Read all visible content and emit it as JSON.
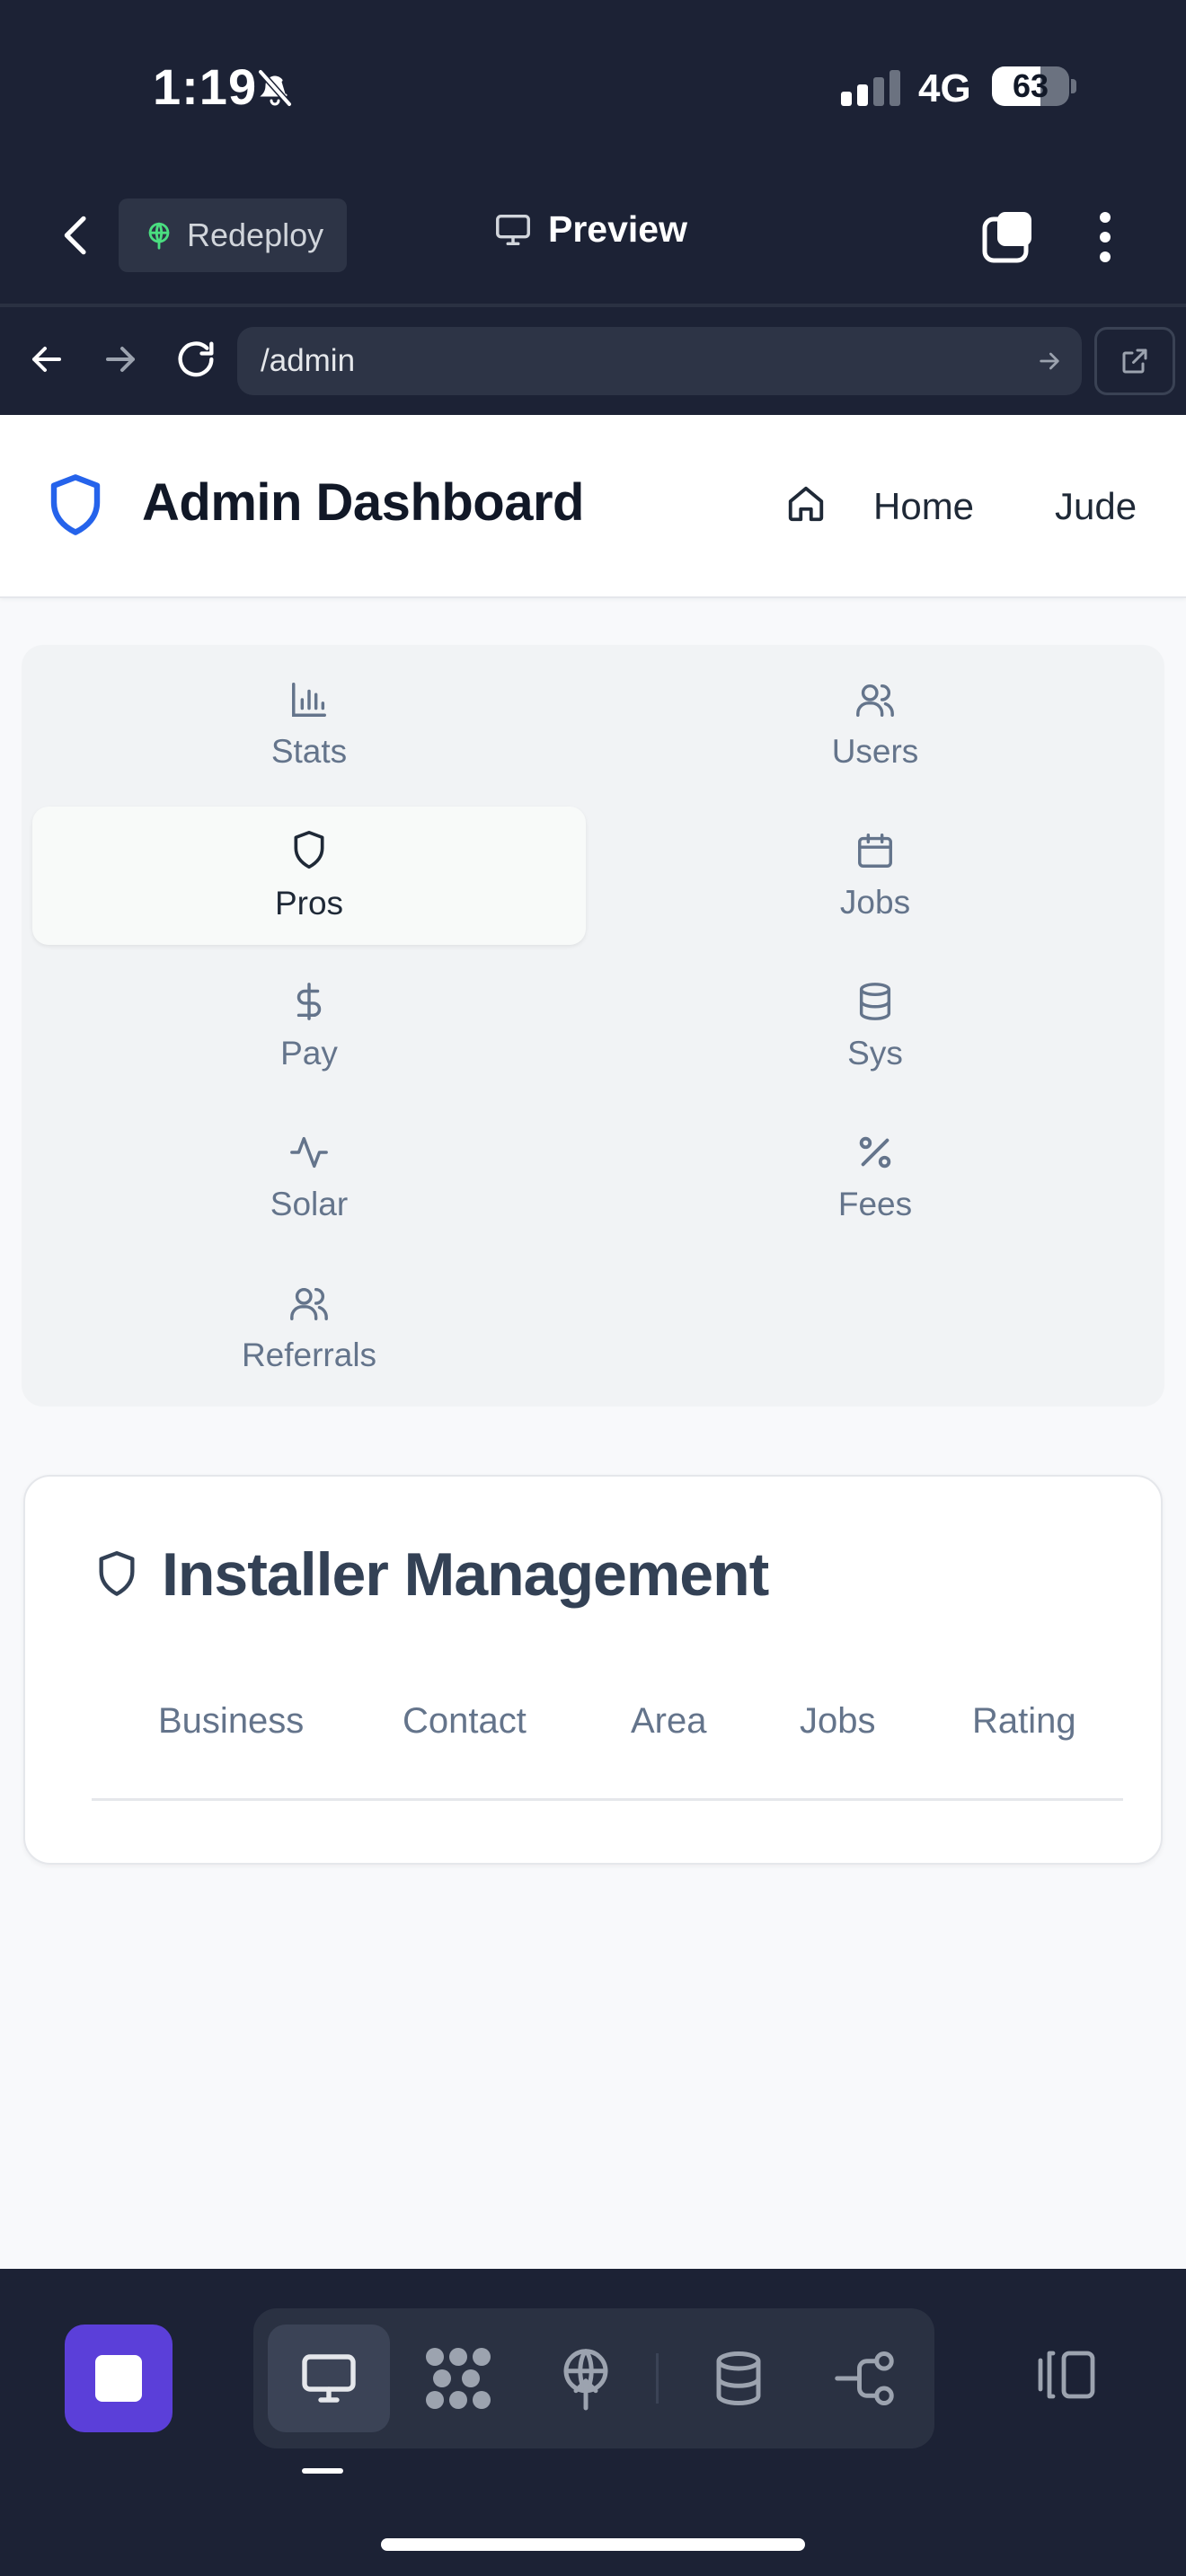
{
  "status_bar": {
    "time": "1:19",
    "network": "4G",
    "battery_percent": "63",
    "battery_level": 0.63,
    "icons": [
      "bell-muted-icon",
      "signal-icon"
    ]
  },
  "browser_chrome": {
    "redeploy_label": "Redeploy",
    "preview_label": "Preview",
    "url": "/admin",
    "icons": [
      "chevron-left-icon",
      "globe-icon",
      "monitor-icon",
      "tabs-icon",
      "more-vertical-icon",
      "arrow-left-icon",
      "arrow-right-icon",
      "reload-icon",
      "external-link-icon"
    ]
  },
  "header": {
    "title": "Admin Dashboard",
    "home_label": "Home",
    "user_label": "Jude"
  },
  "nav": {
    "active": "Pros",
    "items": [
      {
        "label": "Stats",
        "icon": "bar-chart-icon"
      },
      {
        "label": "Users",
        "icon": "users-icon"
      },
      {
        "label": "Pros",
        "icon": "shield-icon"
      },
      {
        "label": "Jobs",
        "icon": "calendar-icon"
      },
      {
        "label": "Pay",
        "icon": "dollar-icon"
      },
      {
        "label": "Sys",
        "icon": "database-icon"
      },
      {
        "label": "Solar",
        "icon": "activity-icon"
      },
      {
        "label": "Fees",
        "icon": "percent-icon"
      },
      {
        "label": "Referrals",
        "icon": "users-icon"
      }
    ]
  },
  "card": {
    "title": "Installer Management",
    "columns": [
      "Business",
      "Contact",
      "Area",
      "Jobs",
      "Rating"
    ]
  },
  "colors": {
    "chrome_bg": "#1c2235",
    "accent_purple": "#5b3fd9",
    "shield_blue": "#2563eb",
    "muted_text": "#64748b"
  }
}
